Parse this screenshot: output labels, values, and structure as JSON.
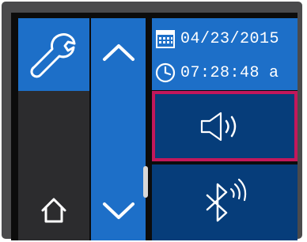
{
  "status": {
    "date": "04/23/2015",
    "time": "07:28:48",
    "period": "a"
  },
  "icons": {
    "settings": "wrench-icon",
    "home": "home-icon",
    "scroll_up": "chevron-up-icon",
    "scroll_down": "chevron-down-icon",
    "calendar": "calendar-icon",
    "clock": "clock-icon",
    "volume": "speaker-volume-icon",
    "bluetooth": "bluetooth-icon"
  },
  "colors": {
    "tile_blue": "#1d6fc8",
    "tile_dark_blue": "#063d7a",
    "selection_highlight": "#c2185b",
    "panel_dark": "#2c2c2e"
  },
  "state": {
    "selected_tile": "volume"
  }
}
